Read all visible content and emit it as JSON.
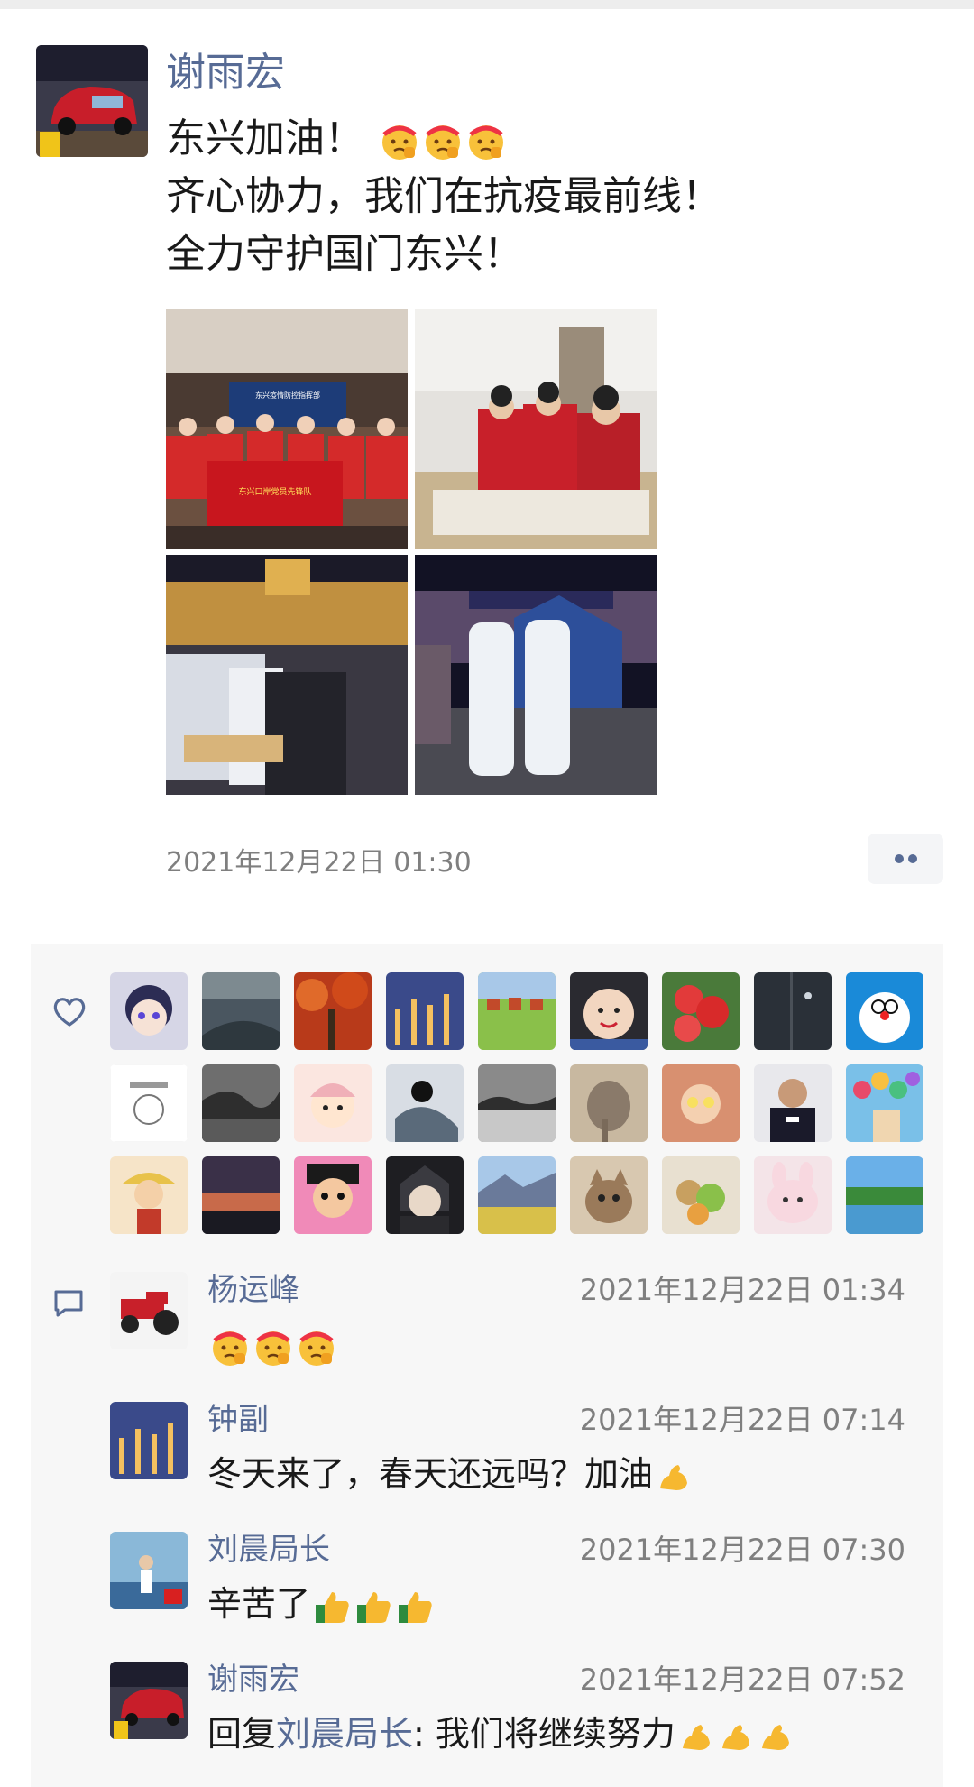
{
  "post": {
    "author": "谢雨宏",
    "lines": [
      "东兴加油！",
      "齐心协力，我们在抗疫最前线！",
      "全力守护国门东兴！"
    ],
    "line1_emoji": [
      "salute-face",
      "salute-face",
      "salute-face"
    ],
    "photo_banner_text": "东兴疫情防控指挥部",
    "photo_sign_text": "东兴口岸党员先锋队",
    "timestamp": "2021年12月22日 01:30"
  },
  "likes": {
    "count_shown": 27,
    "icon": "heart-outline-icon"
  },
  "comments": [
    {
      "name": "杨运峰",
      "time": "2021年12月22日 01:34",
      "text": "",
      "emoji": [
        "salute-face",
        "salute-face",
        "salute-face"
      ]
    },
    {
      "name": "钟副",
      "time": "2021年12月22日 07:14",
      "text": "冬天来了，春天还远吗？加油",
      "emoji": [
        "flexed-biceps"
      ]
    },
    {
      "name": "刘晨局长",
      "time": "2021年12月22日 07:30",
      "text": "辛苦了",
      "emoji": [
        "thumbs-up",
        "thumbs-up",
        "thumbs-up"
      ]
    },
    {
      "name": "谢雨宏",
      "time": "2021年12月22日 07:52",
      "reply_prefix": "回复",
      "reply_to": "刘晨局长",
      "text": ": 我们将继续努力",
      "emoji": [
        "flexed-biceps",
        "flexed-biceps",
        "flexed-biceps"
      ]
    }
  ],
  "colors": {
    "link": "#576b95",
    "text": "#191919",
    "meta": "#7f7f7f",
    "panel": "#f7f7f7"
  }
}
